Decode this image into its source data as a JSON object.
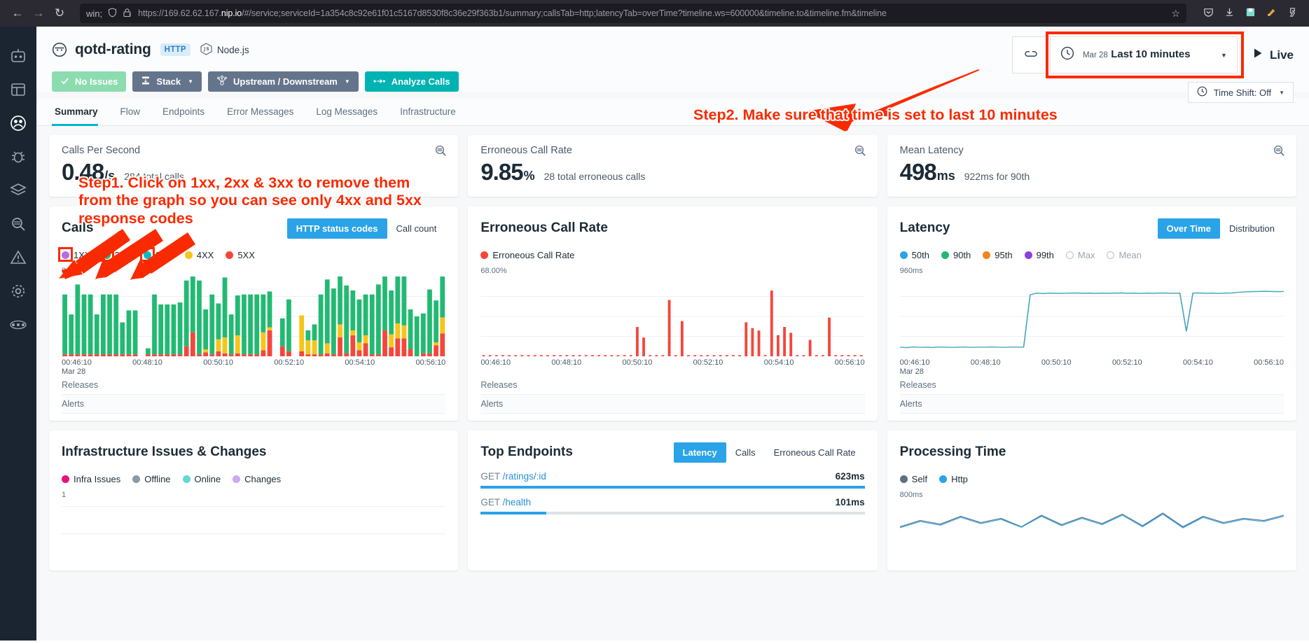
{
  "browser": {
    "back_icon": "back-arrow-icon",
    "forward_icon": "forward-arrow-icon",
    "reload_icon": "reload-icon",
    "url_prefix": "https://169.62.62.167.",
    "url_domain": "nip.io",
    "url_suffix": "/#/service;serviceId=1a354c8c92e61f01c5167d8530f8c36e29f363b1/summary;callsTab=http;latencyTab=overTime?timeline.ws=600000&timeline.to&timeline.fm&timeline",
    "full_url": "https://169.62.62.167.nip.io/#/service;serviceId=1a354c8c92e61f01c5167d8530f8c36e29f363b1/summary;callsTab=http;latencyTab=overTime?timeline.ws=600000&timeline.to&timeline.fm&timeline",
    "icons": [
      "shield-icon",
      "insecure-lock-icon",
      "bookmark-star-icon",
      "pocket-icon",
      "downloads-icon",
      "save-icon",
      "extension-icon",
      "account-icon"
    ]
  },
  "rail": {
    "items": [
      {
        "name": "website-monitoring",
        "icon": "robot-icon",
        "active": false
      },
      {
        "name": "applications",
        "icon": "grid-window-icon",
        "active": false
      },
      {
        "name": "services",
        "icon": "users-icon",
        "active": true
      },
      {
        "name": "endpoints",
        "icon": "bug-icon",
        "active": false
      },
      {
        "name": "infrastructure",
        "icon": "layers-icon",
        "active": false
      },
      {
        "name": "analytics",
        "icon": "magnifier-icon",
        "active": false
      },
      {
        "name": "events",
        "icon": "warning-triangle-icon",
        "active": false
      },
      {
        "name": "settings",
        "icon": "gear-icon",
        "active": false
      },
      {
        "name": "more",
        "icon": "ellipsis-icon",
        "active": false
      }
    ]
  },
  "header": {
    "service_icon": "service-circle-icon",
    "service_name": "qotd-rating",
    "protocol_badge": "HTTP",
    "tech_icon": "nodejs-icon",
    "tech_label": "Node.js",
    "buttons": {
      "no_issues": "No Issues",
      "stack": "Stack",
      "upstream_downstream": "Upstream / Downstream",
      "analyze_calls": "Analyze Calls"
    },
    "link_icon": "chain-link-icon",
    "time_picker": {
      "clock_icon": "clock-icon",
      "date": "Mar 28",
      "range": "Last 10 minutes",
      "caret_icon": "chevron-down-icon",
      "highlighted": true
    },
    "live": {
      "icon": "play-icon",
      "label": "Live"
    },
    "time_shift": {
      "icon": "clock-icon",
      "label": "Time Shift: Off",
      "caret_icon": "chevron-down-icon"
    }
  },
  "tabs": [
    {
      "label": "Summary",
      "active": true
    },
    {
      "label": "Flow",
      "active": false
    },
    {
      "label": "Endpoints",
      "active": false
    },
    {
      "label": "Error Messages",
      "active": false
    },
    {
      "label": "Log Messages",
      "active": false
    },
    {
      "label": "Infrastructure",
      "active": false
    }
  ],
  "kpis": [
    {
      "label": "Calls Per Second",
      "value": "0.48",
      "unit": "/s",
      "sub": "284 total calls",
      "zoom_icon": "zoom-out-icon"
    },
    {
      "label": "Erroneous Call Rate",
      "value": "9.85",
      "unit": "%",
      "sub": "28 total erroneous calls",
      "zoom_icon": "zoom-out-icon"
    },
    {
      "label": "Mean Latency",
      "value": "498",
      "unit": "ms",
      "sub": "922ms for 90th",
      "zoom_icon": "zoom-out-icon"
    }
  ],
  "calls_card": {
    "title": "Calls",
    "segments": [
      {
        "label": "HTTP status codes",
        "active": true
      },
      {
        "label": "Call count",
        "active": false
      }
    ],
    "legend": [
      {
        "label": "1XX",
        "color": "#b36fe0",
        "highlighted": true
      },
      {
        "label": "2XX",
        "color": "#21ba72",
        "highlighted": true
      },
      {
        "label": "3XX",
        "color": "#00bfc4",
        "highlighted": true
      },
      {
        "label": "4XX",
        "color": "#f5c518",
        "highlighted": false
      },
      {
        "label": "5XX",
        "color": "#f5463b",
        "highlighted": false
      }
    ],
    "y_max": "8",
    "x_ticks": [
      "00:46:10",
      "00:48:10",
      "00:50:10",
      "00:52:10",
      "00:54:10",
      "00:56:10"
    ],
    "x_sub": "Mar 28",
    "foot": [
      "Releases",
      "Alerts"
    ]
  },
  "error_card": {
    "title": "Erroneous Call Rate",
    "legend": [
      {
        "label": "Erroneous Call Rate",
        "color": "#f5463b"
      }
    ],
    "y_max": "68.00%",
    "x_ticks": [
      "00:46:10",
      "00:48:10",
      "00:50:10",
      "00:52:10",
      "00:54:10",
      "00:56:10"
    ],
    "foot": [
      "Releases",
      "Alerts"
    ]
  },
  "latency_card": {
    "title": "Latency",
    "segments": [
      {
        "label": "Over Time",
        "active": true
      },
      {
        "label": "Distribution",
        "active": false
      }
    ],
    "legend": [
      {
        "label": "50th",
        "color": "#2aa3e8",
        "on": true
      },
      {
        "label": "90th",
        "color": "#21ba72",
        "on": true
      },
      {
        "label": "95th",
        "color": "#f58220",
        "on": true
      },
      {
        "label": "99th",
        "color": "#8b3fe0",
        "on": true
      },
      {
        "label": "Max",
        "color": "",
        "on": false
      },
      {
        "label": "Mean",
        "color": "",
        "on": false
      }
    ],
    "y_max": "960ms",
    "x_ticks": [
      "00:46:10",
      "00:48:10",
      "00:50:10",
      "00:52:10",
      "00:54:10",
      "00:56:10"
    ],
    "x_sub": "Mar 28",
    "foot": [
      "Releases",
      "Alerts"
    ]
  },
  "infra_card": {
    "title": "Infrastructure Issues & Changes",
    "legend": [
      {
        "label": "Infra Issues",
        "color": "#e8117f"
      },
      {
        "label": "Offline",
        "color": "#8b98a5"
      },
      {
        "label": "Online",
        "color": "#5fd8d8"
      },
      {
        "label": "Changes",
        "color": "#cba8ef"
      }
    ],
    "y_max": "1"
  },
  "endpoints_card": {
    "title": "Top Endpoints",
    "segments": [
      {
        "label": "Latency",
        "active": true
      },
      {
        "label": "Calls",
        "active": false
      },
      {
        "label": "Erroneous Call Rate",
        "active": false
      }
    ],
    "rows": [
      {
        "verb": "GET",
        "path": " /ratings/:id",
        "value": "623ms",
        "pct": 100
      },
      {
        "verb": "GET",
        "path": " /health",
        "value": "101ms",
        "pct": 17
      }
    ]
  },
  "processing_card": {
    "title": "Processing Time",
    "legend": [
      {
        "label": "Self",
        "color": "#5d7083"
      },
      {
        "label": "Http",
        "color": "#2aa3e8"
      }
    ],
    "y_max": "800ms"
  },
  "annotations": [
    {
      "id": "step1",
      "text": "Step1. Click on 1xx, 2xx & 3xx to remove them\nfrom the graph so you can see only 4xx and 5xx\nresponse codes",
      "color": "#fa2a00"
    },
    {
      "id": "step2",
      "text": "Step2. Make sure that time is set to last 10 minutes",
      "color": "#fa2a00"
    }
  ],
  "chart_data": [
    {
      "type": "bar",
      "name": "calls-stacked",
      "title": "Calls",
      "ylabel": "",
      "xlabel": "",
      "ylim": [
        0,
        8
      ],
      "categories": [
        "00:46:10",
        "00:48:10",
        "00:50:10",
        "00:52:10",
        "00:54:10",
        "00:56:10"
      ],
      "series": [
        {
          "name": "2XX",
          "color": "#21ba72",
          "values": [
            6,
            4,
            7,
            6,
            6,
            4,
            6,
            6,
            6,
            3.2,
            4.4,
            4.4,
            0,
            0.6,
            6,
            5,
            5,
            5,
            5.2,
            6.6,
            7.4,
            7.4,
            4,
            6,
            3.6,
            6,
            4,
            4,
            6,
            6,
            6,
            3.8,
            3.6,
            0,
            2.8,
            5.2,
            0,
            0,
            1,
            1.6,
            6,
            6.4,
            6.6,
            4.8,
            6.8,
            4,
            4.3,
            4.1,
            6,
            7,
            6.4,
            4.4,
            5.8,
            5.1,
            4,
            4,
            4,
            6.4,
            4.2,
            4.7
          ]
        },
        {
          "name": "4XX",
          "color": "#f5c518",
          "values": [
            0,
            0,
            0,
            0,
            0,
            0,
            0,
            0,
            0,
            0,
            0,
            0,
            0,
            0,
            0,
            0,
            0,
            0,
            0,
            0,
            0,
            0,
            0.3,
            0,
            1.2,
            1.6,
            0,
            1.8,
            0,
            0,
            0,
            1.8,
            0.3,
            0,
            0,
            0,
            0,
            3.6,
            1.4,
            1.4,
            0,
            1,
            0,
            1.3,
            0,
            0.5,
            0.8,
            0.8,
            0,
            0,
            0,
            1.3,
            1.5,
            1.3,
            0,
            0,
            0,
            0,
            0.3,
            1.6
          ]
        },
        {
          "name": "5XX",
          "color": "#f5463b",
          "values": [
            0.2,
            0.2,
            0.2,
            0.2,
            0.2,
            0.2,
            0.2,
            0.2,
            0.2,
            0.2,
            0.2,
            0.2,
            0,
            0.2,
            0.2,
            0.2,
            0.2,
            0.2,
            0.2,
            1,
            2.4,
            0.2,
            0.4,
            0.2,
            0.5,
            0.3,
            0.2,
            0.3,
            0.2,
            0.2,
            0.2,
            0.6,
            2.6,
            0,
            1,
            0.5,
            0,
            0.5,
            0.2,
            0.2,
            0.2,
            0.3,
            0.2,
            1.9,
            0.3,
            2.1,
            0.6,
            1.3,
            0.2,
            0.2,
            2.6,
            0.9,
            1.8,
            1.8,
            0.7,
            0,
            0.3,
            0.3,
            1.1,
            2.3
          ]
        }
      ]
    },
    {
      "type": "bar",
      "name": "erroneous-call-rate",
      "title": "Erroneous Call Rate",
      "ylim": [
        0,
        68
      ],
      "ylabel": "%",
      "xlabel": "",
      "categories": [
        "00:46:10",
        "00:48:10",
        "00:50:10",
        "00:52:10",
        "00:54:10",
        "00:56:10"
      ],
      "series": [
        {
          "name": "Erroneous Call Rate",
          "color": "#f5463b",
          "values": [
            1,
            1,
            1,
            1,
            1,
            1,
            1,
            1,
            1,
            1,
            1,
            1,
            1,
            1,
            1,
            1,
            1,
            1,
            1,
            1,
            1,
            1,
            1,
            1,
            25,
            16,
            1,
            1,
            1,
            48,
            1,
            30,
            1,
            1,
            1,
            1,
            1,
            1,
            1,
            1,
            1,
            29,
            24,
            22,
            1,
            56,
            18,
            25,
            20,
            1,
            1,
            14,
            1,
            1,
            33,
            1,
            1,
            1,
            1,
            1
          ]
        }
      ]
    },
    {
      "type": "line",
      "name": "latency-over-time",
      "title": "Latency",
      "ylim": [
        0,
        960
      ],
      "ylabel": "ms",
      "xlabel": "",
      "series": [
        {
          "name": "50th",
          "color": "#2aa3e8",
          "values": [
            110,
            105,
            112,
            108,
            110,
            106,
            112,
            110,
            108,
            110,
            112,
            108,
            110,
            110,
            112,
            110,
            108,
            112,
            110,
            110,
            740,
            760,
            755,
            760,
            757,
            758,
            760,
            762,
            758,
            760,
            757,
            760,
            758,
            760,
            762,
            758,
            760,
            757,
            760,
            758,
            762,
            760,
            758,
            760,
            300,
            760,
            762,
            758,
            760,
            757,
            760,
            762,
            770,
            775,
            778,
            780,
            782,
            780,
            778,
            780
          ]
        }
      ]
    },
    {
      "type": "line",
      "name": "processing-time",
      "title": "Processing Time",
      "ylim": [
        0,
        800
      ],
      "series": [
        {
          "name": "Self",
          "color": "#5d7083",
          "values": [
            300,
            420,
            350,
            500,
            380,
            460,
            300,
            520,
            340,
            480,
            360,
            540,
            320,
            560,
            300,
            500,
            380,
            460,
            420,
            520
          ]
        },
        {
          "name": "Http",
          "color": "#2aa3e8",
          "values": [
            280,
            400,
            330,
            480,
            360,
            440,
            290,
            500,
            320,
            460,
            340,
            520,
            300,
            540,
            280,
            480,
            360,
            440,
            400,
            500
          ]
        }
      ]
    },
    {
      "type": "bar",
      "name": "infrastructure-issues-changes",
      "title": "Infrastructure Issues & Changes",
      "ylim": [
        0,
        1
      ],
      "series": [
        {
          "name": "Infra Issues",
          "color": "#e8117f",
          "values": []
        }
      ]
    }
  ]
}
